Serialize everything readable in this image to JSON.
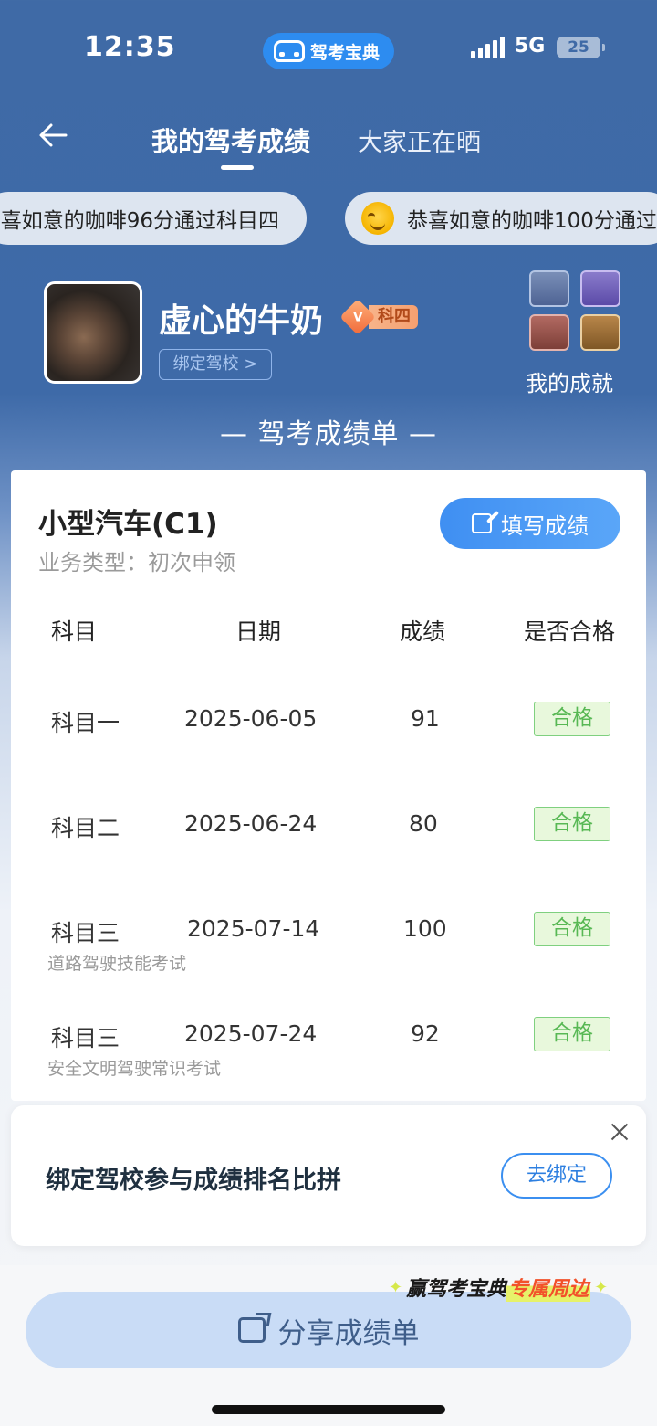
{
  "status_bar": {
    "time": "12:35",
    "app_name": "驾考宝典",
    "network": "5G",
    "battery": "25"
  },
  "header": {
    "tab_active": "我的驾考成绩",
    "tab_other": "大家正在晒"
  },
  "marquee": {
    "item1": "喜如意的咖啡96分通过科目四",
    "item2": "恭喜如意的咖啡100分通过"
  },
  "profile": {
    "nickname": "虚心的牛奶",
    "badge_v": "V",
    "badge_text": "科四",
    "bind_school": "绑定驾校 >",
    "achievements_label": "我的成就"
  },
  "report_title": "— 驾考成绩单 —",
  "card": {
    "vehicle": "小型汽车(C1)",
    "business_type": "业务类型：初次申领",
    "fill_button": "填写成绩",
    "headers": [
      "科目",
      "日期",
      "成绩",
      "是否合格"
    ],
    "rows": [
      {
        "subject": "科目一",
        "date": "2025-06-05",
        "score": "91",
        "status": "合格",
        "note": ""
      },
      {
        "subject": "科目二",
        "date": "2025-06-24",
        "score": "80",
        "status": "合格",
        "note": ""
      },
      {
        "subject": "科目三",
        "date": "2025-07-14",
        "score": "100",
        "status": "合格",
        "note": "道路驾驶技能考试"
      },
      {
        "subject": "科目三",
        "date": "2025-07-24",
        "score": "92",
        "status": "合格",
        "note": "安全文明驾驶常识考试"
      }
    ]
  },
  "popup": {
    "text": "绑定驾校参与成绩排名比拼",
    "button": "去绑定"
  },
  "promo": {
    "part1": "赢驾考宝典",
    "part2": "专属周边"
  },
  "share_button": "分享成绩单",
  "colors": {
    "primary": "#3f6aa6",
    "accent": "#2d8cf0",
    "pass_green": "#58b854"
  }
}
